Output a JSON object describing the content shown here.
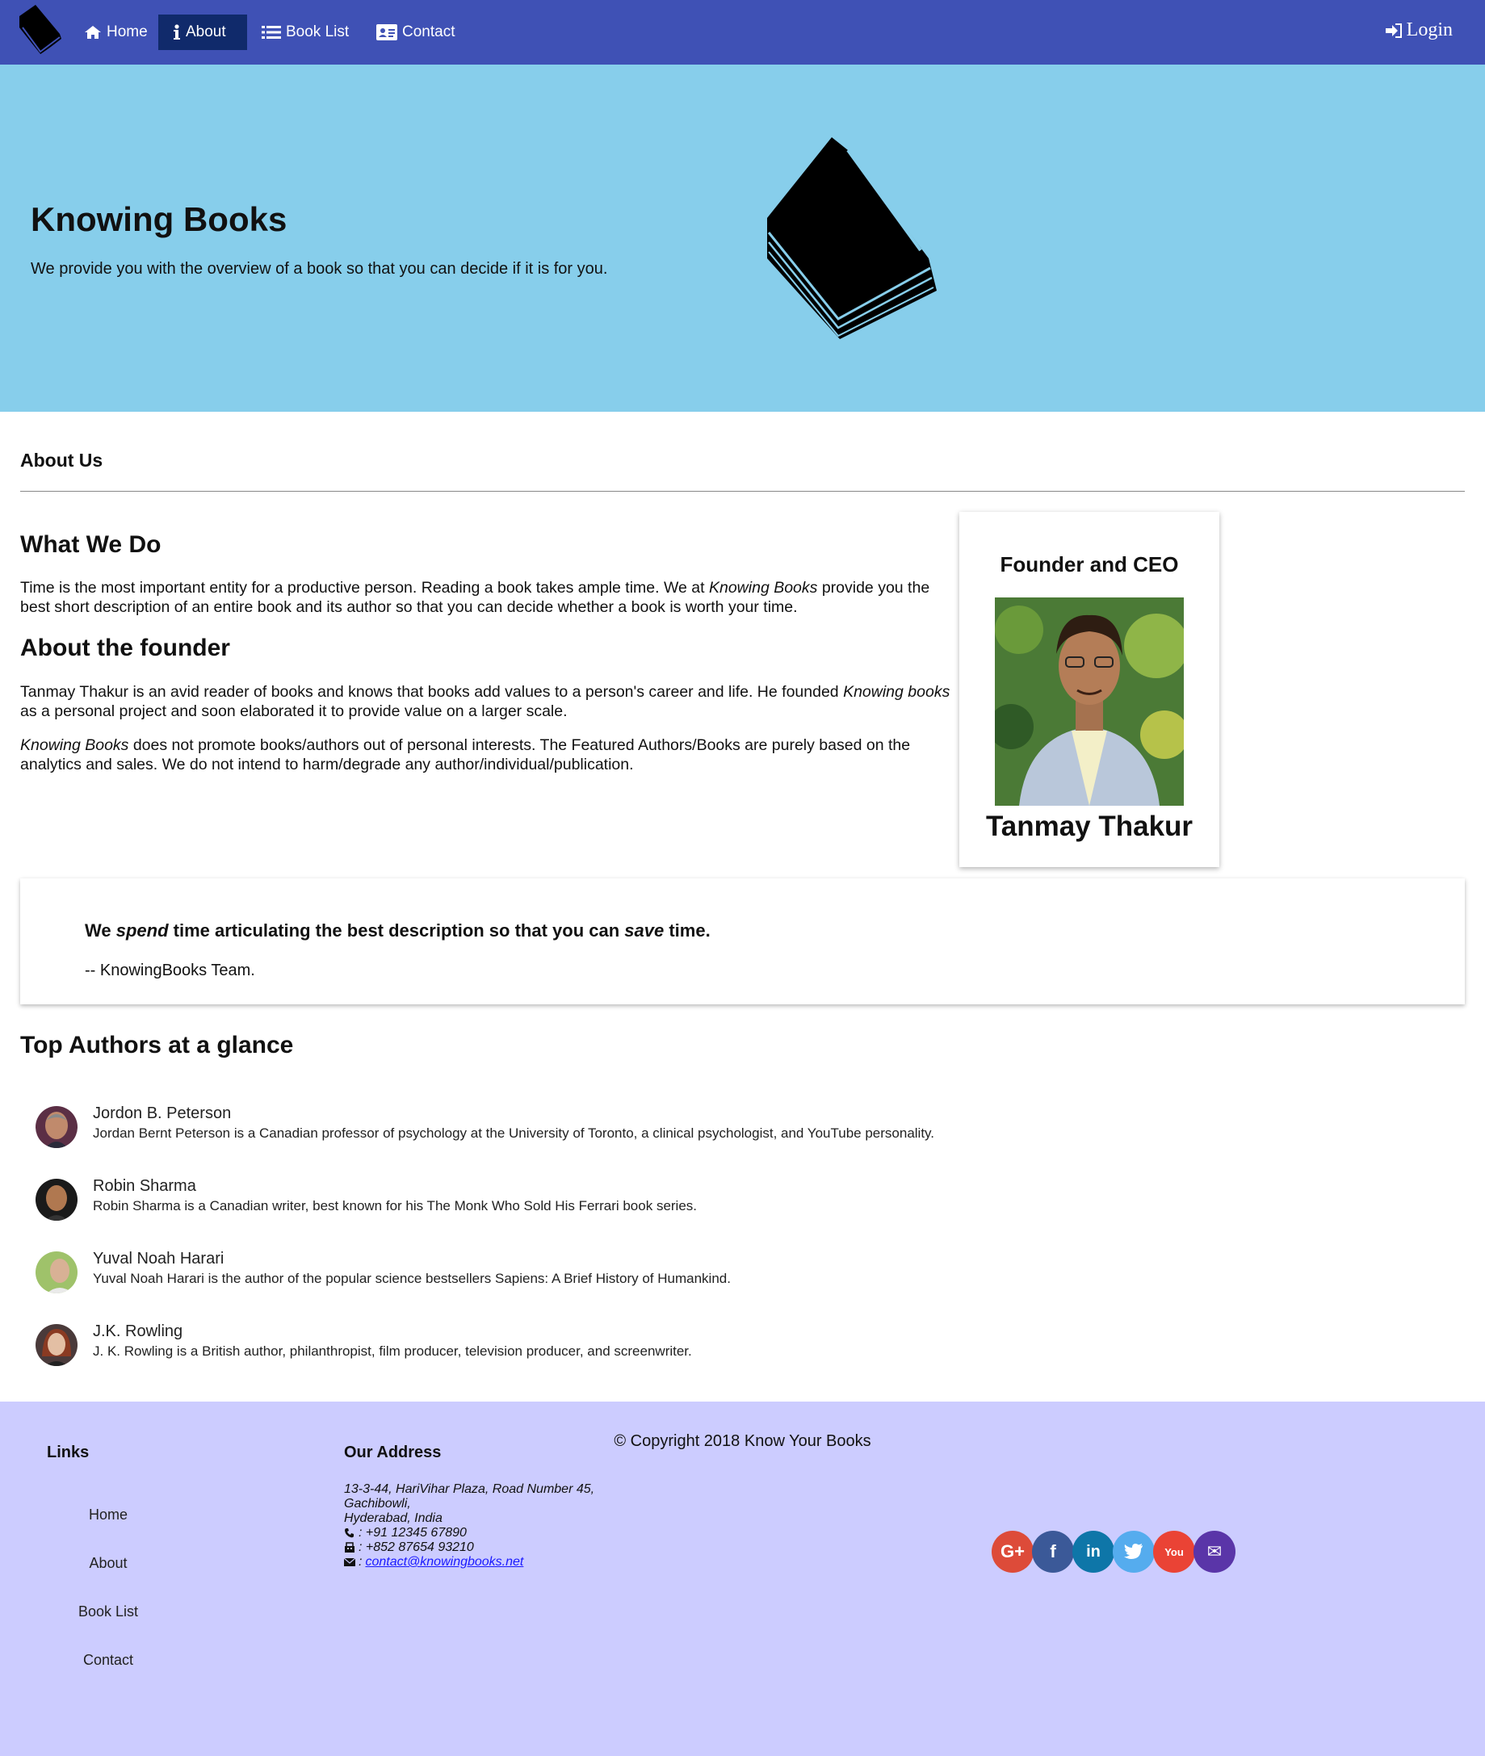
{
  "navbar": {
    "items": [
      {
        "label": "Home",
        "icon": "home-icon"
      },
      {
        "label": "About",
        "icon": "info-icon",
        "active": true
      },
      {
        "label": "Book List",
        "icon": "list-icon"
      },
      {
        "label": "Contact",
        "icon": "address-card-icon"
      }
    ],
    "login_label": "Login",
    "color": "#3f51b5",
    "active_color": "#102a6b"
  },
  "hero": {
    "title": "Knowing Books",
    "subtitle": "We provide you with the overview of a book so that you can decide if it is for you.",
    "background": "#87ceeb"
  },
  "about": {
    "heading": "About Us",
    "what_we_do_heading": "What We Do",
    "what_we_do_pre": "Time is the most important entity for a productive person. Reading a book takes ample time. We at ",
    "what_we_do_em": "Knowing Books",
    "what_we_do_post": " provide you the best short description of an entire book and its author so that you can decide whether a book is worth your time.",
    "founder_heading": "About the founder",
    "founder_pre": "Tanmay Thakur is an avid reader of books and knows that books add values to a person's career and life. He founded ",
    "founder_em": "Knowing books",
    "founder_post": " as a personal project and soon elaborated it to provide value on a larger scale.",
    "policy_em": "Knowing Books",
    "policy_post": " does not promote books/authors out of personal interests. The Featured Authors/Books are purely based on the analytics and sales. We do not intend to harm/degrade any author/individual/publication."
  },
  "founder_card": {
    "role": "Founder and CEO",
    "name": "Tanmay Thakur"
  },
  "quote": {
    "t1": "We ",
    "em1": "spend",
    "t2": " time articulating the best description so that you can ",
    "em2": "save",
    "t3": " time.",
    "author": "-- KnowingBooks Team."
  },
  "authors": {
    "heading": "Top Authors at a glance",
    "items": [
      {
        "name": "Jordon B. Peterson",
        "desc": "Jordan Bernt Peterson is a Canadian professor of psychology at the University of Toronto, a clinical psychologist, and YouTube personality."
      },
      {
        "name": "Robin Sharma",
        "desc": "Robin Sharma is a Canadian writer, best known for his The Monk Who Sold His Ferrari book series."
      },
      {
        "name": "Yuval Noah Harari",
        "desc": "Yuval Noah Harari is the author of the popular science bestsellers Sapiens: A Brief History of Humankind."
      },
      {
        "name": "J.K. Rowling",
        "desc": "J. K. Rowling is a British author, philanthropist, film producer, television producer, and screenwriter."
      }
    ]
  },
  "footer": {
    "links_heading": "Links",
    "links": [
      "Home",
      "About",
      "Book List",
      "Contact"
    ],
    "address_heading": "Our Address",
    "address_line1": "13-3-44, HariVihar Plaza, Road Number 45,",
    "address_line2": "Gachibowli,",
    "address_line3": "Hyderabad, India",
    "phone": ": +91 12345 67890",
    "fax": ": +852 87654 93210",
    "email": "contact@knowingbooks.net",
    "social": [
      {
        "icon": "google-plus-icon",
        "color": "#dd4b39",
        "glyph": "G+"
      },
      {
        "icon": "facebook-icon",
        "color": "#3b5998",
        "glyph": "f"
      },
      {
        "icon": "linkedin-icon",
        "color": "#0e76a8",
        "glyph": "in"
      },
      {
        "icon": "twitter-icon",
        "color": "#55acee",
        "glyph": "t"
      },
      {
        "icon": "youtube-icon",
        "color": "#ea4335",
        "glyph": "You"
      },
      {
        "icon": "mail-icon",
        "color": "#5a35a8",
        "glyph": "✉"
      }
    ],
    "background": "#ccccff",
    "copyright": "© Copyright 2018 Know Your Books"
  }
}
